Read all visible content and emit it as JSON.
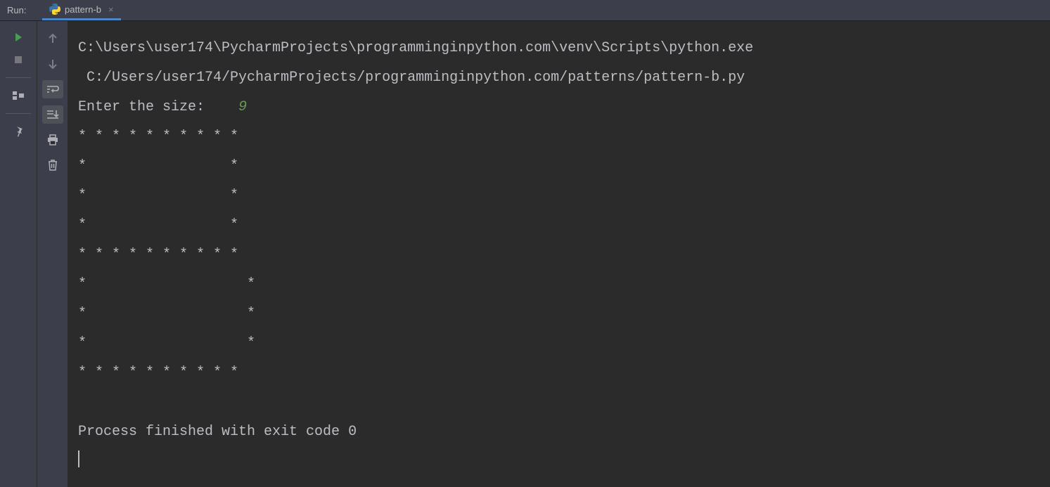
{
  "tabbar": {
    "run_label": "Run:",
    "tab_name": "pattern-b"
  },
  "console": {
    "cmd_line1": "C:\\Users\\user174\\PycharmProjects\\programminginpython.com\\venv\\Scripts\\python.exe",
    "cmd_indent": " ",
    "cmd_line2": "C:/Users/user174/PycharmProjects/programminginpython.com/patterns/pattern-b.py",
    "prompt_text": "Enter the size:    ",
    "input_value": "9",
    "pattern": [
      "* * * * * * * * * *",
      "*                 *",
      "*                 *",
      "*                 *",
      "* * * * * * * * * *",
      "*                   *",
      "*                   *",
      "*                   *",
      "* * * * * * * * * *"
    ],
    "blank": "",
    "exit_msg": "Process finished with exit code 0"
  }
}
